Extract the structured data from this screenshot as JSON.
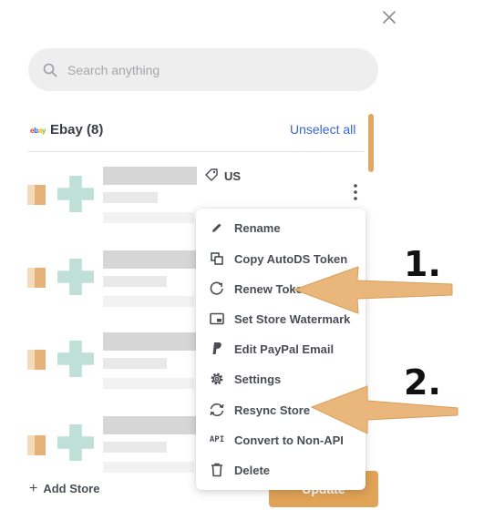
{
  "dialog": {
    "close_icon": "close-icon"
  },
  "search": {
    "placeholder": "Search anything",
    "icon": "search-icon"
  },
  "section": {
    "title": "Ebay (8)",
    "unselect_label": "Unselect all",
    "logo_text": "ebay"
  },
  "store_row": {
    "country": "US"
  },
  "menu": {
    "items": [
      {
        "label": "Rename",
        "icon": "pencil-icon"
      },
      {
        "label": "Copy AutoDS Token",
        "icon": "copy-icon"
      },
      {
        "label": "Renew Token",
        "icon": "refresh-icon"
      },
      {
        "label": "Set Store Watermark",
        "icon": "watermark-icon"
      },
      {
        "label": "Edit PayPal Email",
        "icon": "paypal-icon"
      },
      {
        "label": "Settings",
        "icon": "gear-icon"
      },
      {
        "label": "Resync Store",
        "icon": "sync-icon"
      },
      {
        "label": "Convert to Non-API",
        "icon": "api-icon",
        "icon_text": "API"
      },
      {
        "label": "Delete",
        "icon": "trash-icon"
      }
    ]
  },
  "footer": {
    "add_store_label": "Add Store",
    "update_label": "Update"
  },
  "annotations": {
    "label_1": "1.",
    "label_2": "2."
  },
  "colors": {
    "accent": "#e0a357",
    "link": "#3567d6",
    "arrow": "#e9b77c"
  }
}
